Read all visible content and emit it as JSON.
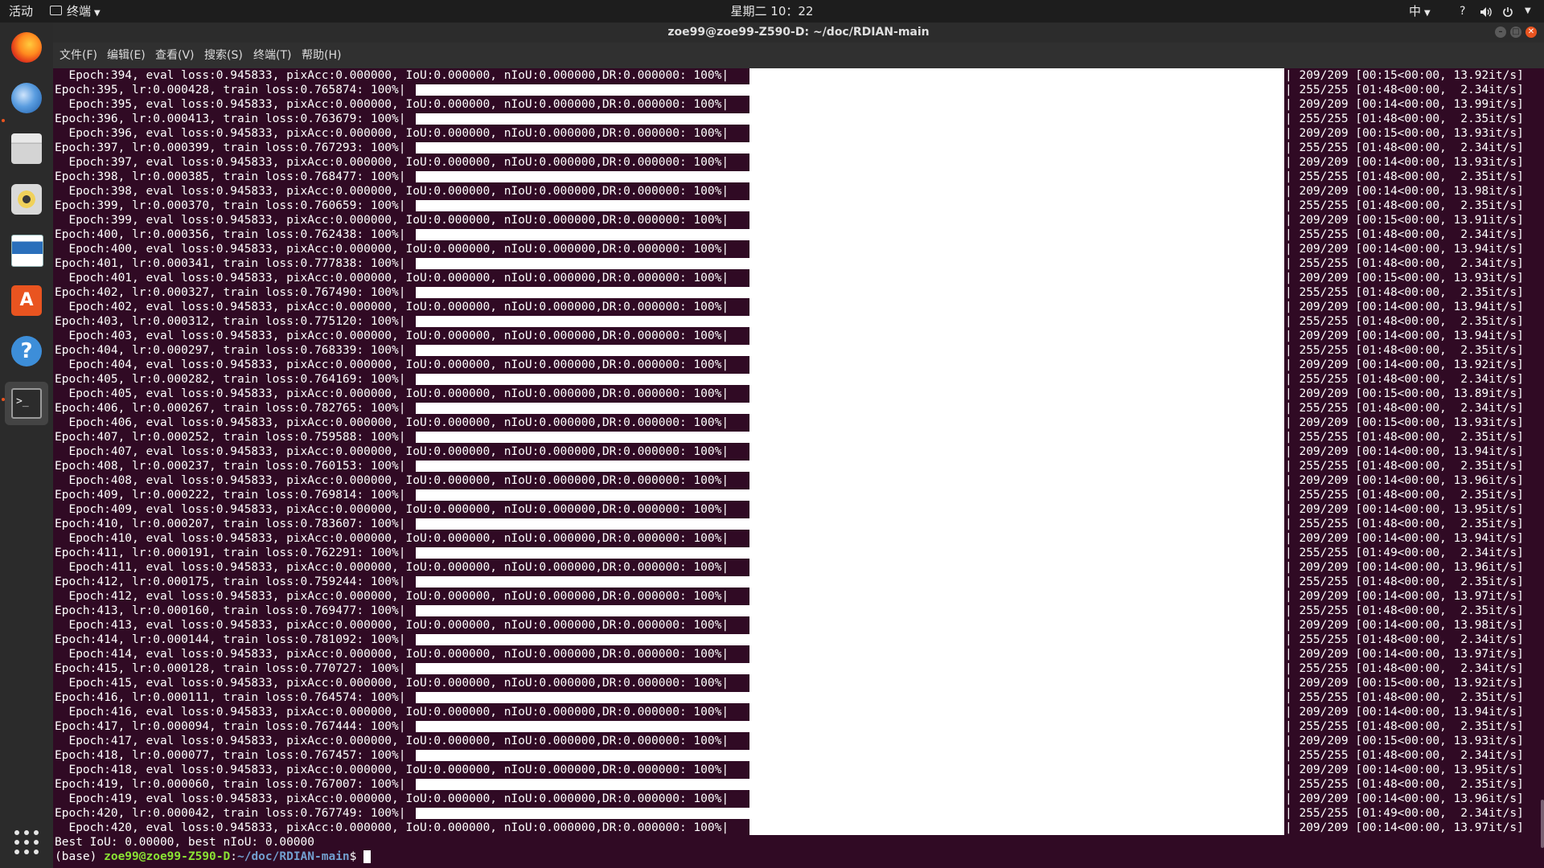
{
  "topbar": {
    "activities": "活动",
    "app_menu": "终端",
    "clock": "星期二 10：22",
    "ime": "中",
    "help": "?",
    "volume_icon": "speaker-icon",
    "power_icon": "power-icon"
  },
  "dock": {
    "items": [
      {
        "name": "firefox",
        "icon": "firefox-icon",
        "color": "#e66000"
      },
      {
        "name": "thunderbird",
        "icon": "thunderbird-icon",
        "color": "#2f7bc4"
      },
      {
        "name": "files",
        "icon": "files-icon",
        "color": "#cfcfcf"
      },
      {
        "name": "rhythmbox",
        "icon": "rhythmbox-icon",
        "color": "#e8c64a"
      },
      {
        "name": "writer",
        "icon": "writer-icon",
        "color": "#2a6fbb"
      },
      {
        "name": "software",
        "icon": "software-icon",
        "color": "#e95420"
      },
      {
        "name": "help",
        "icon": "help-icon",
        "color": "#3d8ed9"
      },
      {
        "name": "terminal",
        "icon": "terminal-icon",
        "color": "#2b2b2b"
      }
    ],
    "show_apps_icon": "grid-icon"
  },
  "window": {
    "title": "zoe99@zoe99-Z590-D: ~/doc/RDIAN-main",
    "menu": [
      "文件(F)",
      "编辑(E)",
      "查看(V)",
      "搜索(S)",
      "终端(T)",
      "帮助(H)"
    ]
  },
  "terminal": {
    "lines": [
      {
        "kind": "eval",
        "text": "  Epoch:394, eval loss:0.945833, pixAcc:0.000000, IoU:0.000000, nIoU:0.000000,DR:0.000000: 100%|",
        "right": "| 209/209 [00:15<00:00, 13.92it/s]"
      },
      {
        "kind": "train",
        "text": "Epoch:395, lr:0.000428, train loss:0.765874: 100%|",
        "right": "| 255/255 [01:48<00:00,  2.34it/s]"
      },
      {
        "kind": "eval",
        "text": "  Epoch:395, eval loss:0.945833, pixAcc:0.000000, IoU:0.000000, nIoU:0.000000,DR:0.000000: 100%|",
        "right": "| 209/209 [00:14<00:00, 13.99it/s]"
      },
      {
        "kind": "train",
        "text": "Epoch:396, lr:0.000413, train loss:0.763679: 100%|",
        "right": "| 255/255 [01:48<00:00,  2.35it/s]"
      },
      {
        "kind": "eval",
        "text": "  Epoch:396, eval loss:0.945833, pixAcc:0.000000, IoU:0.000000, nIoU:0.000000,DR:0.000000: 100%|",
        "right": "| 209/209 [00:15<00:00, 13.93it/s]"
      },
      {
        "kind": "train",
        "text": "Epoch:397, lr:0.000399, train loss:0.767293: 100%|",
        "right": "| 255/255 [01:48<00:00,  2.34it/s]"
      },
      {
        "kind": "eval",
        "text": "  Epoch:397, eval loss:0.945833, pixAcc:0.000000, IoU:0.000000, nIoU:0.000000,DR:0.000000: 100%|",
        "right": "| 209/209 [00:14<00:00, 13.93it/s]"
      },
      {
        "kind": "train",
        "text": "Epoch:398, lr:0.000385, train loss:0.768477: 100%|",
        "right": "| 255/255 [01:48<00:00,  2.35it/s]"
      },
      {
        "kind": "eval",
        "text": "  Epoch:398, eval loss:0.945833, pixAcc:0.000000, IoU:0.000000, nIoU:0.000000,DR:0.000000: 100%|",
        "right": "| 209/209 [00:14<00:00, 13.98it/s]"
      },
      {
        "kind": "train",
        "text": "Epoch:399, lr:0.000370, train loss:0.760659: 100%|",
        "right": "| 255/255 [01:48<00:00,  2.35it/s]"
      },
      {
        "kind": "eval",
        "text": "  Epoch:399, eval loss:0.945833, pixAcc:0.000000, IoU:0.000000, nIoU:0.000000,DR:0.000000: 100%|",
        "right": "| 209/209 [00:15<00:00, 13.91it/s]"
      },
      {
        "kind": "train",
        "text": "Epoch:400, lr:0.000356, train loss:0.762438: 100%|",
        "right": "| 255/255 [01:48<00:00,  2.34it/s]"
      },
      {
        "kind": "eval",
        "text": "  Epoch:400, eval loss:0.945833, pixAcc:0.000000, IoU:0.000000, nIoU:0.000000,DR:0.000000: 100%|",
        "right": "| 209/209 [00:14<00:00, 13.94it/s]"
      },
      {
        "kind": "train",
        "text": "Epoch:401, lr:0.000341, train loss:0.777838: 100%|",
        "right": "| 255/255 [01:48<00:00,  2.34it/s]"
      },
      {
        "kind": "eval",
        "text": "  Epoch:401, eval loss:0.945833, pixAcc:0.000000, IoU:0.000000, nIoU:0.000000,DR:0.000000: 100%|",
        "right": "| 209/209 [00:15<00:00, 13.93it/s]"
      },
      {
        "kind": "train",
        "text": "Epoch:402, lr:0.000327, train loss:0.767490: 100%|",
        "right": "| 255/255 [01:48<00:00,  2.35it/s]"
      },
      {
        "kind": "eval",
        "text": "  Epoch:402, eval loss:0.945833, pixAcc:0.000000, IoU:0.000000, nIoU:0.000000,DR:0.000000: 100%|",
        "right": "| 209/209 [00:14<00:00, 13.94it/s]"
      },
      {
        "kind": "train",
        "text": "Epoch:403, lr:0.000312, train loss:0.775120: 100%|",
        "right": "| 255/255 [01:48<00:00,  2.35it/s]"
      },
      {
        "kind": "eval",
        "text": "  Epoch:403, eval loss:0.945833, pixAcc:0.000000, IoU:0.000000, nIoU:0.000000,DR:0.000000: 100%|",
        "right": "| 209/209 [00:14<00:00, 13.94it/s]"
      },
      {
        "kind": "train",
        "text": "Epoch:404, lr:0.000297, train loss:0.768339: 100%|",
        "right": "| 255/255 [01:48<00:00,  2.35it/s]"
      },
      {
        "kind": "eval",
        "text": "  Epoch:404, eval loss:0.945833, pixAcc:0.000000, IoU:0.000000, nIoU:0.000000,DR:0.000000: 100%|",
        "right": "| 209/209 [00:14<00:00, 13.92it/s]"
      },
      {
        "kind": "train",
        "text": "Epoch:405, lr:0.000282, train loss:0.764169: 100%|",
        "right": "| 255/255 [01:48<00:00,  2.34it/s]"
      },
      {
        "kind": "eval",
        "text": "  Epoch:405, eval loss:0.945833, pixAcc:0.000000, IoU:0.000000, nIoU:0.000000,DR:0.000000: 100%|",
        "right": "| 209/209 [00:15<00:00, 13.89it/s]"
      },
      {
        "kind": "train",
        "text": "Epoch:406, lr:0.000267, train loss:0.782765: 100%|",
        "right": "| 255/255 [01:48<00:00,  2.34it/s]"
      },
      {
        "kind": "eval",
        "text": "  Epoch:406, eval loss:0.945833, pixAcc:0.000000, IoU:0.000000, nIoU:0.000000,DR:0.000000: 100%|",
        "right": "| 209/209 [00:15<00:00, 13.93it/s]"
      },
      {
        "kind": "train",
        "text": "Epoch:407, lr:0.000252, train loss:0.759588: 100%|",
        "right": "| 255/255 [01:48<00:00,  2.35it/s]"
      },
      {
        "kind": "eval",
        "text": "  Epoch:407, eval loss:0.945833, pixAcc:0.000000, IoU:0.000000, nIoU:0.000000,DR:0.000000: 100%|",
        "right": "| 209/209 [00:14<00:00, 13.94it/s]"
      },
      {
        "kind": "train",
        "text": "Epoch:408, lr:0.000237, train loss:0.760153: 100%|",
        "right": "| 255/255 [01:48<00:00,  2.35it/s]"
      },
      {
        "kind": "eval",
        "text": "  Epoch:408, eval loss:0.945833, pixAcc:0.000000, IoU:0.000000, nIoU:0.000000,DR:0.000000: 100%|",
        "right": "| 209/209 [00:14<00:00, 13.96it/s]"
      },
      {
        "kind": "train",
        "text": "Epoch:409, lr:0.000222, train loss:0.769814: 100%|",
        "right": "| 255/255 [01:48<00:00,  2.35it/s]"
      },
      {
        "kind": "eval",
        "text": "  Epoch:409, eval loss:0.945833, pixAcc:0.000000, IoU:0.000000, nIoU:0.000000,DR:0.000000: 100%|",
        "right": "| 209/209 [00:14<00:00, 13.95it/s]"
      },
      {
        "kind": "train",
        "text": "Epoch:410, lr:0.000207, train loss:0.783607: 100%|",
        "right": "| 255/255 [01:48<00:00,  2.35it/s]"
      },
      {
        "kind": "eval",
        "text": "  Epoch:410, eval loss:0.945833, pixAcc:0.000000, IoU:0.000000, nIoU:0.000000,DR:0.000000: 100%|",
        "right": "| 209/209 [00:14<00:00, 13.94it/s]"
      },
      {
        "kind": "train",
        "text": "Epoch:411, lr:0.000191, train loss:0.762291: 100%|",
        "right": "| 255/255 [01:49<00:00,  2.34it/s]"
      },
      {
        "kind": "eval",
        "text": "  Epoch:411, eval loss:0.945833, pixAcc:0.000000, IoU:0.000000, nIoU:0.000000,DR:0.000000: 100%|",
        "right": "| 209/209 [00:14<00:00, 13.96it/s]"
      },
      {
        "kind": "train",
        "text": "Epoch:412, lr:0.000175, train loss:0.759244: 100%|",
        "right": "| 255/255 [01:48<00:00,  2.35it/s]"
      },
      {
        "kind": "eval",
        "text": "  Epoch:412, eval loss:0.945833, pixAcc:0.000000, IoU:0.000000, nIoU:0.000000,DR:0.000000: 100%|",
        "right": "| 209/209 [00:14<00:00, 13.97it/s]"
      },
      {
        "kind": "train",
        "text": "Epoch:413, lr:0.000160, train loss:0.769477: 100%|",
        "right": "| 255/255 [01:48<00:00,  2.35it/s]"
      },
      {
        "kind": "eval",
        "text": "  Epoch:413, eval loss:0.945833, pixAcc:0.000000, IoU:0.000000, nIoU:0.000000,DR:0.000000: 100%|",
        "right": "| 209/209 [00:14<00:00, 13.98it/s]"
      },
      {
        "kind": "train",
        "text": "Epoch:414, lr:0.000144, train loss:0.781092: 100%|",
        "right": "| 255/255 [01:48<00:00,  2.34it/s]"
      },
      {
        "kind": "eval",
        "text": "  Epoch:414, eval loss:0.945833, pixAcc:0.000000, IoU:0.000000, nIoU:0.000000,DR:0.000000: 100%|",
        "right": "| 209/209 [00:14<00:00, 13.97it/s]"
      },
      {
        "kind": "train",
        "text": "Epoch:415, lr:0.000128, train loss:0.770727: 100%|",
        "right": "| 255/255 [01:48<00:00,  2.34it/s]"
      },
      {
        "kind": "eval",
        "text": "  Epoch:415, eval loss:0.945833, pixAcc:0.000000, IoU:0.000000, nIoU:0.000000,DR:0.000000: 100%|",
        "right": "| 209/209 [00:15<00:00, 13.92it/s]"
      },
      {
        "kind": "train",
        "text": "Epoch:416, lr:0.000111, train loss:0.764574: 100%|",
        "right": "| 255/255 [01:48<00:00,  2.35it/s]"
      },
      {
        "kind": "eval",
        "text": "  Epoch:416, eval loss:0.945833, pixAcc:0.000000, IoU:0.000000, nIoU:0.000000,DR:0.000000: 100%|",
        "right": "| 209/209 [00:14<00:00, 13.94it/s]"
      },
      {
        "kind": "train",
        "text": "Epoch:417, lr:0.000094, train loss:0.767444: 100%|",
        "right": "| 255/255 [01:48<00:00,  2.35it/s]"
      },
      {
        "kind": "eval",
        "text": "  Epoch:417, eval loss:0.945833, pixAcc:0.000000, IoU:0.000000, nIoU:0.000000,DR:0.000000: 100%|",
        "right": "| 209/209 [00:15<00:00, 13.93it/s]"
      },
      {
        "kind": "train",
        "text": "Epoch:418, lr:0.000077, train loss:0.767457: 100%|",
        "right": "| 255/255 [01:48<00:00,  2.34it/s]"
      },
      {
        "kind": "eval",
        "text": "  Epoch:418, eval loss:0.945833, pixAcc:0.000000, IoU:0.000000, nIoU:0.000000,DR:0.000000: 100%|",
        "right": "| 209/209 [00:14<00:00, 13.95it/s]"
      },
      {
        "kind": "train",
        "text": "Epoch:419, lr:0.000060, train loss:0.767007: 100%|",
        "right": "| 255/255 [01:48<00:00,  2.35it/s]"
      },
      {
        "kind": "eval",
        "text": "  Epoch:419, eval loss:0.945833, pixAcc:0.000000, IoU:0.000000, nIoU:0.000000,DR:0.000000: 100%|",
        "right": "| 209/209 [00:14<00:00, 13.96it/s]"
      },
      {
        "kind": "train",
        "text": "Epoch:420, lr:0.000042, train loss:0.767749: 100%|",
        "right": "| 255/255 [01:49<00:00,  2.34it/s]"
      },
      {
        "kind": "eval",
        "text": "  Epoch:420, eval loss:0.945833, pixAcc:0.000000, IoU:0.000000, nIoU:0.000000,DR:0.000000: 100%|",
        "right": "| 209/209 [00:14<00:00, 13.97it/s]"
      }
    ],
    "best_line": "Best IoU: 0.00000, best nIoU: 0.00000",
    "prompt": {
      "env": "(base) ",
      "user_host": "zoe99@zoe99-Z590-D",
      "sep": ":",
      "path": "~/doc/RDIAN-main",
      "symbol": "$ "
    }
  }
}
